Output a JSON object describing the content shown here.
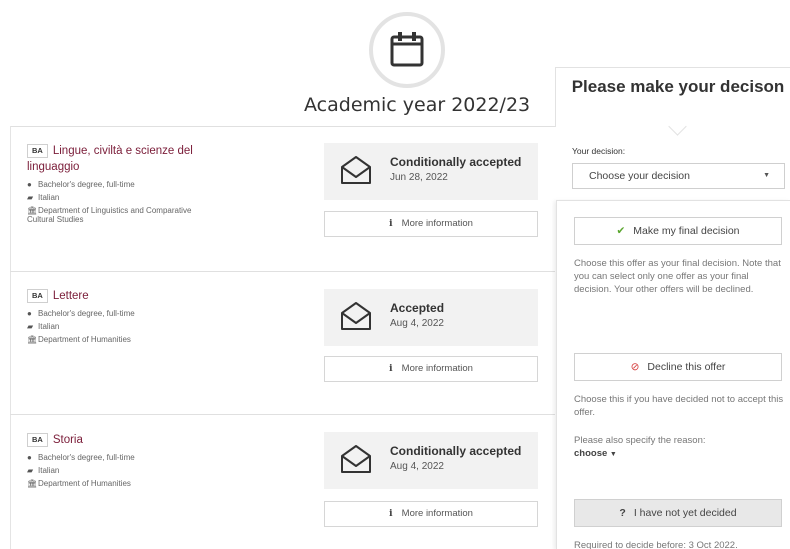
{
  "header": {
    "title": "Academic year 2022/23"
  },
  "offers": [
    {
      "degree_badge": "BA",
      "title": "Lingue, civiltà e scienze del linguaggio",
      "degree_type": "Bachelor's degree, full-time",
      "language": "Italian",
      "department": "Department of Linguistics and Comparative Cultural Studies",
      "status": "Conditionally accepted",
      "date": "Jun 28, 2022",
      "more_info": "More information"
    },
    {
      "degree_badge": "BA",
      "title": "Lettere",
      "degree_type": "Bachelor's degree, full-time",
      "language": "Italian",
      "department": "Department of Humanities",
      "status": "Accepted",
      "date": "Aug 4, 2022",
      "more_info": "More information"
    },
    {
      "degree_badge": "BA",
      "title": "Storia",
      "degree_type": "Bachelor's degree, full-time",
      "language": "Italian",
      "department": "Department of Humanities",
      "status": "Conditionally accepted",
      "date": "Aug 4, 2022",
      "more_info": "More information"
    }
  ],
  "decision_panel": {
    "title": "Please make your decison",
    "label": "Your decision:",
    "select_placeholder": "Choose your decision",
    "final": {
      "button": "Make my final decision",
      "text": "Choose this offer as your final decision. Note that you can select only one offer as your final decision. Your other offers will be declined."
    },
    "decline": {
      "button": "Decline this offer",
      "text": "Choose this if you have decided not to accept this offer.",
      "reason_label": "Please also specify the reason:",
      "reason_choose": "choose"
    },
    "undecided": {
      "button": "I have not yet decided",
      "deadline": "Required to decide before: 3 Oct 2022."
    }
  },
  "colors": {
    "program_title": "#7a1c38",
    "check": "#5aa62e",
    "decline": "#d53b3b",
    "status_bg": "#f2f2f2"
  }
}
